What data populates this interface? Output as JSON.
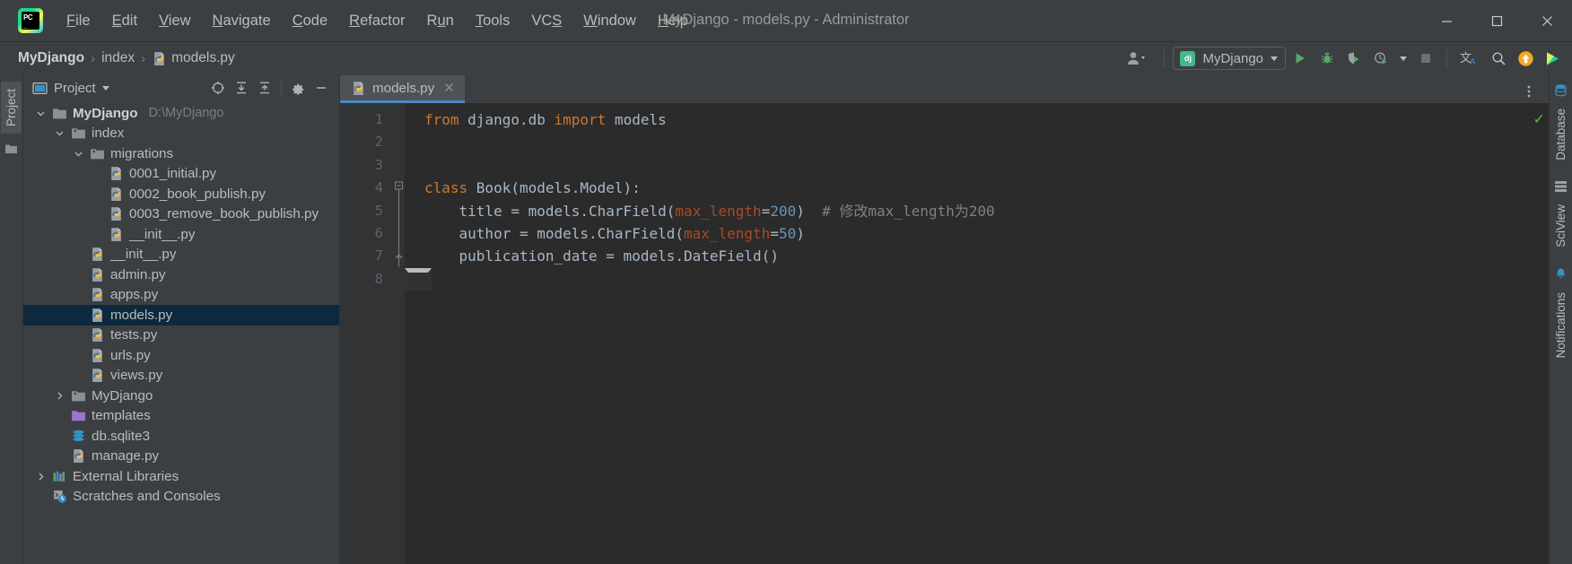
{
  "window": {
    "title": "MyDjango - models.py - Administrator",
    "logo_icon": "pycharm-logo-icon",
    "minimize_label": "Minimize",
    "maximize_label": "Maximize",
    "close_label": "Close"
  },
  "menubar": [
    {
      "label": "File",
      "mnemonic": "F"
    },
    {
      "label": "Edit",
      "mnemonic": "E"
    },
    {
      "label": "View",
      "mnemonic": "V"
    },
    {
      "label": "Navigate",
      "mnemonic": "N"
    },
    {
      "label": "Code",
      "mnemonic": "C"
    },
    {
      "label": "Refactor",
      "mnemonic": "R"
    },
    {
      "label": "Run",
      "mnemonic": "u"
    },
    {
      "label": "Tools",
      "mnemonic": "T"
    },
    {
      "label": "VCS",
      "mnemonic": "S"
    },
    {
      "label": "Window",
      "mnemonic": "W"
    },
    {
      "label": "Help",
      "mnemonic": "H"
    }
  ],
  "breadcrumb": {
    "items": [
      {
        "label": "MyDjango",
        "icon": "none",
        "bold": true
      },
      {
        "label": "index",
        "icon": "none",
        "bold": false
      },
      {
        "label": "models.py",
        "icon": "python-file-icon",
        "bold": false
      }
    ],
    "separator": "›"
  },
  "toolbar": {
    "account_icon": "user-account-icon",
    "run_config": {
      "label": "MyDjango",
      "icon": "django-icon"
    },
    "run_icon": "run-icon",
    "debug_icon": "debug-icon",
    "coverage_icon": "run-with-coverage-icon",
    "profile_icon": "profile-icon",
    "stop_icon": "stop-icon",
    "translate_icon": "translate-icon",
    "search_icon": "search-everywhere-icon",
    "update_icon": "update-available-icon",
    "plugin_icon": "ide-plugin-icon"
  },
  "left_strip": {
    "tabs": [
      {
        "label": "Project",
        "selected": true
      }
    ],
    "structure_icon": "folder-strip-icon"
  },
  "right_strip": {
    "tabs": [
      {
        "label": "Database",
        "icon": "database-icon"
      },
      {
        "label": "SciView",
        "icon": "sciview-icon"
      },
      {
        "label": "Notifications",
        "icon": "notifications-icon"
      }
    ]
  },
  "project_panel": {
    "title": "Project",
    "dropdown_icon": "chevron-down-icon",
    "icons": {
      "select_opened_file": "locate-target-icon",
      "expand_all": "expand-all-icon",
      "collapse_all": "collapse-all-icon",
      "settings": "gear-icon",
      "hide": "minimize-icon"
    },
    "tree": [
      {
        "label": "MyDjango",
        "sub": "D:\\MyDjango",
        "indent": 0,
        "arrow": "down",
        "icon": "folder-module-icon",
        "bold": true,
        "selected": false
      },
      {
        "label": "index",
        "sub": "",
        "indent": 1,
        "arrow": "down",
        "icon": "folder-source-icon",
        "bold": false,
        "selected": false
      },
      {
        "label": "migrations",
        "sub": "",
        "indent": 2,
        "arrow": "down",
        "icon": "folder-source-icon",
        "bold": false,
        "selected": false
      },
      {
        "label": "0001_initial.py",
        "sub": "",
        "indent": 3,
        "arrow": "none",
        "icon": "python-file-icon",
        "bold": false,
        "selected": false
      },
      {
        "label": "0002_book_publish.py",
        "sub": "",
        "indent": 3,
        "arrow": "none",
        "icon": "python-file-icon",
        "bold": false,
        "selected": false
      },
      {
        "label": "0003_remove_book_publish.py",
        "sub": "",
        "indent": 3,
        "arrow": "none",
        "icon": "python-file-icon",
        "bold": false,
        "selected": false
      },
      {
        "label": "__init__.py",
        "sub": "",
        "indent": 3,
        "arrow": "none",
        "icon": "python-file-icon",
        "bold": false,
        "selected": false
      },
      {
        "label": "__init__.py",
        "sub": "",
        "indent": 2,
        "arrow": "none",
        "icon": "python-file-icon",
        "bold": false,
        "selected": false
      },
      {
        "label": "admin.py",
        "sub": "",
        "indent": 2,
        "arrow": "none",
        "icon": "python-file-icon",
        "bold": false,
        "selected": false
      },
      {
        "label": "apps.py",
        "sub": "",
        "indent": 2,
        "arrow": "none",
        "icon": "python-file-icon",
        "bold": false,
        "selected": false
      },
      {
        "label": "models.py",
        "sub": "",
        "indent": 2,
        "arrow": "none",
        "icon": "python-file-icon",
        "bold": false,
        "selected": true
      },
      {
        "label": "tests.py",
        "sub": "",
        "indent": 2,
        "arrow": "none",
        "icon": "python-file-icon",
        "bold": false,
        "selected": false
      },
      {
        "label": "urls.py",
        "sub": "",
        "indent": 2,
        "arrow": "none",
        "icon": "python-file-icon",
        "bold": false,
        "selected": false
      },
      {
        "label": "views.py",
        "sub": "",
        "indent": 2,
        "arrow": "none",
        "icon": "python-file-icon",
        "bold": false,
        "selected": false
      },
      {
        "label": "MyDjango",
        "sub": "",
        "indent": 1,
        "arrow": "right",
        "icon": "folder-source-icon",
        "bold": false,
        "selected": false
      },
      {
        "label": "templates",
        "sub": "",
        "indent": 1,
        "arrow": "none",
        "icon": "folder-templates-icon",
        "bold": false,
        "selected": false
      },
      {
        "label": "db.sqlite3",
        "sub": "",
        "indent": 1,
        "arrow": "none",
        "icon": "database-file-icon",
        "bold": false,
        "selected": false
      },
      {
        "label": "manage.py",
        "sub": "",
        "indent": 1,
        "arrow": "none",
        "icon": "python-file-icon",
        "bold": false,
        "selected": false
      },
      {
        "label": "External Libraries",
        "sub": "",
        "indent": 0,
        "arrow": "right",
        "icon": "external-libraries-icon",
        "bold": false,
        "selected": false
      },
      {
        "label": "Scratches and Consoles",
        "sub": "",
        "indent": 0,
        "arrow": "none",
        "icon": "scratches-icon",
        "bold": false,
        "selected": false
      }
    ]
  },
  "editor": {
    "tabs": [
      {
        "label": "models.py",
        "icon": "python-file-icon",
        "close_icon": "close-icon",
        "active": true
      }
    ],
    "options_icon": "more-options-icon",
    "inspection_status_icon": "inspection-ok-icon",
    "line_numbers": [
      "1",
      "2",
      "3",
      "4",
      "5",
      "6",
      "7",
      "8"
    ],
    "caret_line": 8,
    "lines": [
      {
        "n": 1,
        "tokens": [
          {
            "t": "from ",
            "c": "kw"
          },
          {
            "t": "django.db ",
            "c": "plain"
          },
          {
            "t": "import ",
            "c": "kw"
          },
          {
            "t": "models",
            "c": "plain"
          }
        ]
      },
      {
        "n": 2,
        "tokens": []
      },
      {
        "n": 3,
        "tokens": []
      },
      {
        "n": 4,
        "fold": "start",
        "tokens": [
          {
            "t": "class ",
            "c": "kw"
          },
          {
            "t": "Book(models.Model):",
            "c": "plain"
          }
        ]
      },
      {
        "n": 5,
        "tokens": [
          {
            "t": "    title = models.CharField(",
            "c": "plain"
          },
          {
            "t": "max_length",
            "c": "kwarg"
          },
          {
            "t": "=",
            "c": "plain"
          },
          {
            "t": "200",
            "c": "num"
          },
          {
            "t": ")  ",
            "c": "plain"
          },
          {
            "t": "# 修改max_length为200",
            "c": "cmt"
          }
        ]
      },
      {
        "n": 6,
        "tokens": [
          {
            "t": "    author = models.CharField(",
            "c": "plain"
          },
          {
            "t": "max_length",
            "c": "kwarg"
          },
          {
            "t": "=",
            "c": "plain"
          },
          {
            "t": "50",
            "c": "num"
          },
          {
            "t": ")",
            "c": "plain"
          }
        ]
      },
      {
        "n": 7,
        "fold": "end",
        "tokens": [
          {
            "t": "    publication_date = models.DateField()",
            "c": "plain"
          }
        ]
      },
      {
        "n": 8,
        "tokens": []
      }
    ]
  },
  "colors": {
    "accent_blue": "#4a88c7",
    "selection_navy": "#0d293e",
    "keyword_orange": "#cc7832",
    "number_blue": "#6897bb",
    "kwarg_red": "#aa4926",
    "comment_gray": "#808080",
    "editor_bg": "#2b2b2b",
    "panel_bg": "#3c3f41",
    "run_green": "#59a869",
    "update_orange": "#f5a623"
  }
}
